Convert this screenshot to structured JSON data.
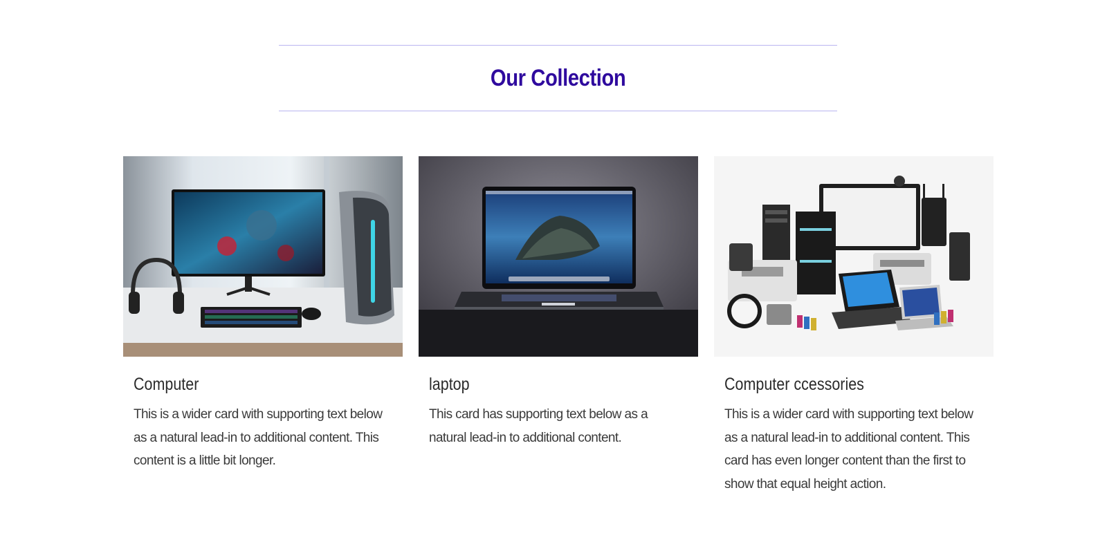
{
  "section": {
    "title": "Our Collection"
  },
  "cards": [
    {
      "title": "Computer",
      "text": "This is a wider card with supporting text below as a natural lead-in to additional content. This content is a little bit longer.",
      "image_icon": "desktop-computer-image"
    },
    {
      "title": "laptop",
      "text": "This card has supporting text below as a natural lead-in to additional content.",
      "image_icon": "laptop-image"
    },
    {
      "title": "Computer ccessories",
      "text": "This is a wider card with supporting text below as a natural lead-in to additional content. This card has even longer content than the first to show that equal height action.",
      "image_icon": "computer-accessories-image"
    }
  ],
  "colors": {
    "title": "#2f0a9e",
    "divider": "#b9b4f0",
    "text": "#333333"
  }
}
